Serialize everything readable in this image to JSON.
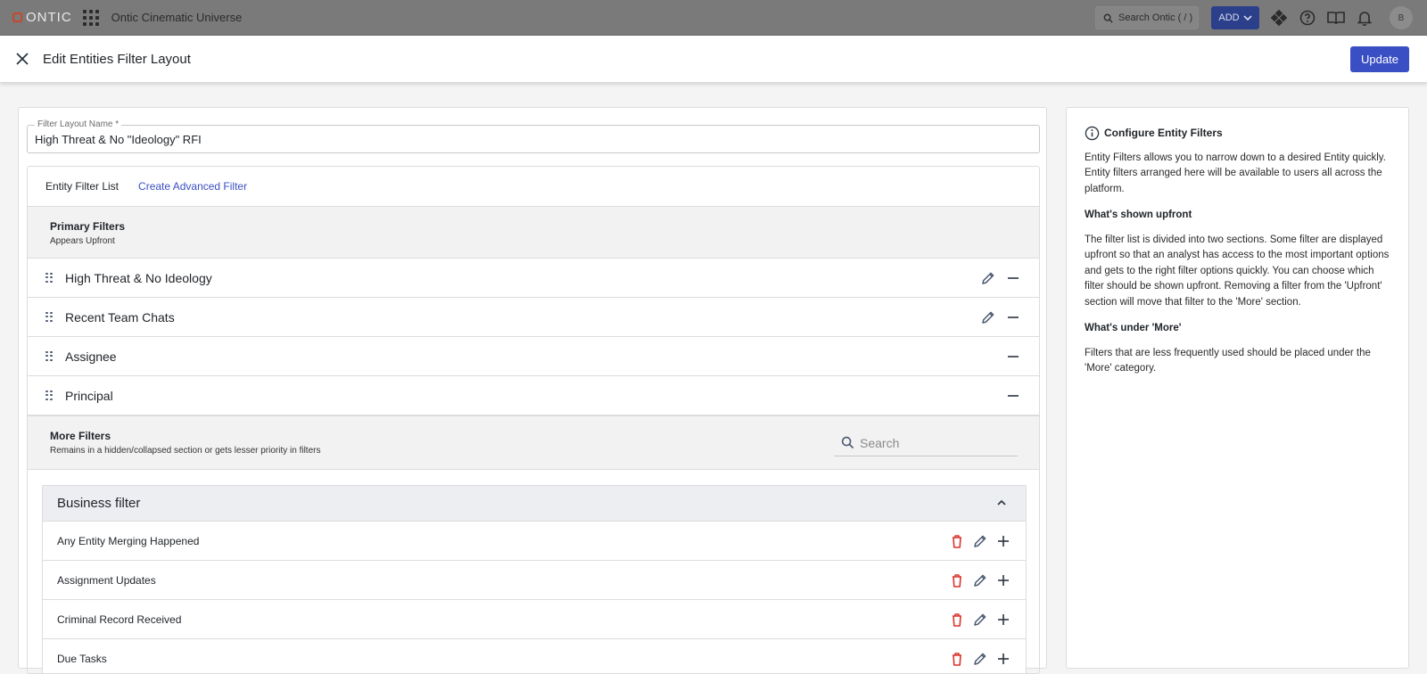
{
  "topbar": {
    "logo_text": "ONTIC",
    "app_title": "Ontic Cinematic Universe",
    "search_placeholder": "Search Ontic ( / )",
    "add_label": "ADD",
    "avatar_initial": "B"
  },
  "header": {
    "title": "Edit Entities Filter Layout",
    "update_label": "Update"
  },
  "form": {
    "name_label": "Filter Layout Name *",
    "name_value": "High Threat & No \"Ideology\" RFI"
  },
  "tabs": {
    "list_label": "Entity Filter List",
    "advanced_label": "Create Advanced Filter"
  },
  "primary": {
    "title": "Primary Filters",
    "subtitle": "Appears Upfront",
    "items": [
      {
        "label": "High Threat & No Ideology",
        "editable": true
      },
      {
        "label": "Recent Team Chats",
        "editable": true
      },
      {
        "label": "Assignee",
        "editable": false
      },
      {
        "label": "Principal",
        "editable": false
      }
    ]
  },
  "more": {
    "title": "More Filters",
    "subtitle": "Remains in a hidden/collapsed section or gets lesser priority in filters",
    "search_placeholder": "Search"
  },
  "business": {
    "title": "Business filter",
    "items": [
      {
        "label": "Any Entity Merging Happened"
      },
      {
        "label": "Assignment Updates"
      },
      {
        "label": "Criminal Record Received"
      },
      {
        "label": "Due Tasks"
      }
    ]
  },
  "help": {
    "title": "Configure Entity Filters",
    "intro": "Entity Filters allows you to narrow down to a desired Entity quickly. Entity filters arranged here will be available to users all across the platform.",
    "upfront_title": "What's shown upfront",
    "upfront_text": "The filter list is divided into two sections. Some filter are displayed upfront so that an analyst has access to the most important options and gets to the right filter options quickly. You can choose which filter should be shown upfront. Removing a filter from the 'Upfront' section will move that filter to the 'More' section.",
    "more_title": "What's under 'More'",
    "more_text": "Filters that are less frequently used should be placed under the 'More' category."
  },
  "colors": {
    "accent": "#3a4fc3",
    "danger": "#d9342b",
    "icon": "#4b5870"
  }
}
